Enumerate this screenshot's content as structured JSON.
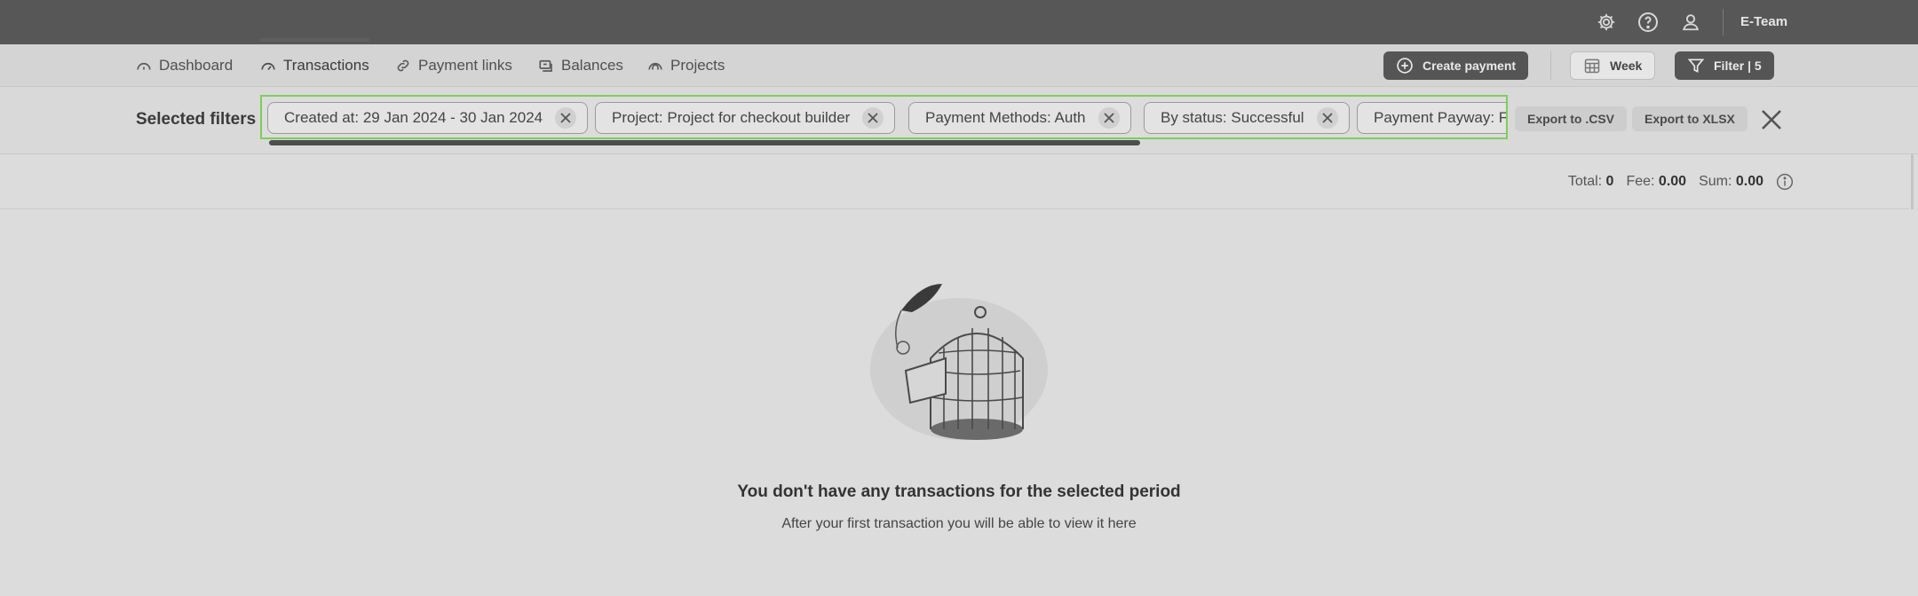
{
  "topbar": {
    "team_label": "E-Team",
    "icons": [
      "settings-icon",
      "help-icon",
      "user-icon"
    ]
  },
  "nav": {
    "items": [
      {
        "label": "Dashboard",
        "icon": "dashboard-icon"
      },
      {
        "label": "Transactions",
        "icon": "transactions-icon",
        "active": true
      },
      {
        "label": "Payment links",
        "icon": "link-icon"
      },
      {
        "label": "Balances",
        "icon": "balances-icon"
      },
      {
        "label": "Projects",
        "icon": "projects-icon"
      }
    ],
    "create_payment": "Create payment",
    "period": "Week",
    "filter": "Filter | 5"
  },
  "filters": {
    "label": "Selected filters",
    "chips": [
      "Created at: 29 Jan 2024 - 30 Jan 2024",
      "Project: Project for checkout builder",
      "Payment Methods: Auth",
      "By status: Successful",
      "Payment Payway: F"
    ],
    "export_csv": "Export to .CSV",
    "export_xlsx": "Export to XLSX"
  },
  "totals": {
    "total_label": "Total:",
    "total_value": "0",
    "fee_label": "Fee:",
    "fee_value": "0.00",
    "sum_label": "Sum:",
    "sum_value": "0.00"
  },
  "empty_state": {
    "title": "You don't have any transactions for the selected period",
    "subtitle": "After your first transaction you will be able to view it here"
  },
  "colors": {
    "topbar": "#575757",
    "highlight_border": "#7ccf5a",
    "background": "#dcdcdc"
  }
}
